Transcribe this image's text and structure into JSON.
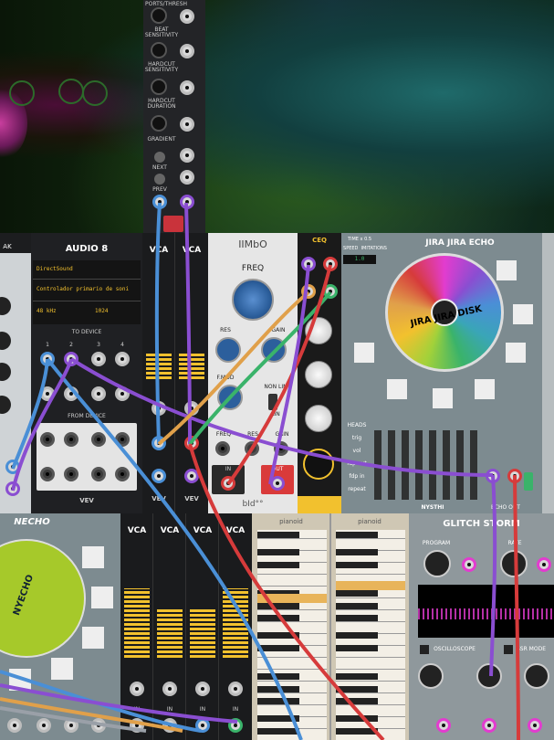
{
  "top_module": {
    "labels": [
      "PORTS/THRESH",
      "BEAT\nSENSITIVITY",
      "HARDCUT\nSENSITIVITY",
      "HARDCUT\nDURATION",
      "GRADIENT",
      "NEXT",
      "PREV"
    ]
  },
  "audio8": {
    "title": "AUDIO 8",
    "driver": "DirectSound",
    "device": "Controlador primario de soni",
    "rate": "48 kHz",
    "block": "1024",
    "to_device": "TO DEVICE",
    "from_device": "FROM DEVICE",
    "brand": "VEV",
    "channels_top": [
      "1",
      "2",
      "3",
      "4"
    ]
  },
  "vca_top": {
    "title1": "VCA",
    "title2": "VCA",
    "brand": "VEV"
  },
  "ilmbo": {
    "title": "IIMbO",
    "freq": "FREQ",
    "res": "RES",
    "gain": "GAIN",
    "fmod": "F.MOD",
    "switch_top": "NON LIN",
    "switch_bottom": "LIN",
    "jacks": [
      "FREQ",
      "RES",
      "GAIN"
    ],
    "in": "IN",
    "out": "OUT",
    "brand": "bId°°"
  },
  "ceq": {
    "title": "CEQ"
  },
  "jira": {
    "title": "JIRA JIRA ECHO",
    "disk_label": "JIRA JIRA DISK",
    "time": "TIME x 0.5",
    "speed": "SPEED  IMITATIONS",
    "display": "1.0",
    "heads": "HEADS",
    "rows": [
      "trig",
      "vol",
      "fdp out",
      "fdp in",
      "repeat"
    ],
    "brand": "NYSTHI",
    "echo_out": "ECHO OUT"
  },
  "necho": {
    "title": "NECHO",
    "subtitle": "ECHO ECH...",
    "disk": "NYECHO"
  },
  "vca_bottom": {
    "titles": [
      "VCA",
      "VCA",
      "VCA",
      "VCA"
    ],
    "labels": [
      "IN",
      "IN",
      "IN",
      "IN"
    ]
  },
  "pianoid": {
    "titles": [
      "pianoid",
      "pianoid"
    ]
  },
  "glitch": {
    "title": "GLITCH STORM",
    "program": "PROGRAM",
    "rate": "RATE",
    "oscilloscope": "OSCILLOSCOPE",
    "ssr_mode": "SSR MODE"
  },
  "left_partial": {
    "text": "AK"
  },
  "colors": {
    "cable_blue": "#4a8fd6",
    "cable_purple": "#8a4ed1",
    "cable_orange": "#e0a04a",
    "cable_green": "#3ab36a",
    "cable_red": "#d63b3b",
    "cable_gray": "#9aa0a8",
    "accent_magenta": "#e23ccf",
    "led_yellow": "#f2c12e"
  }
}
